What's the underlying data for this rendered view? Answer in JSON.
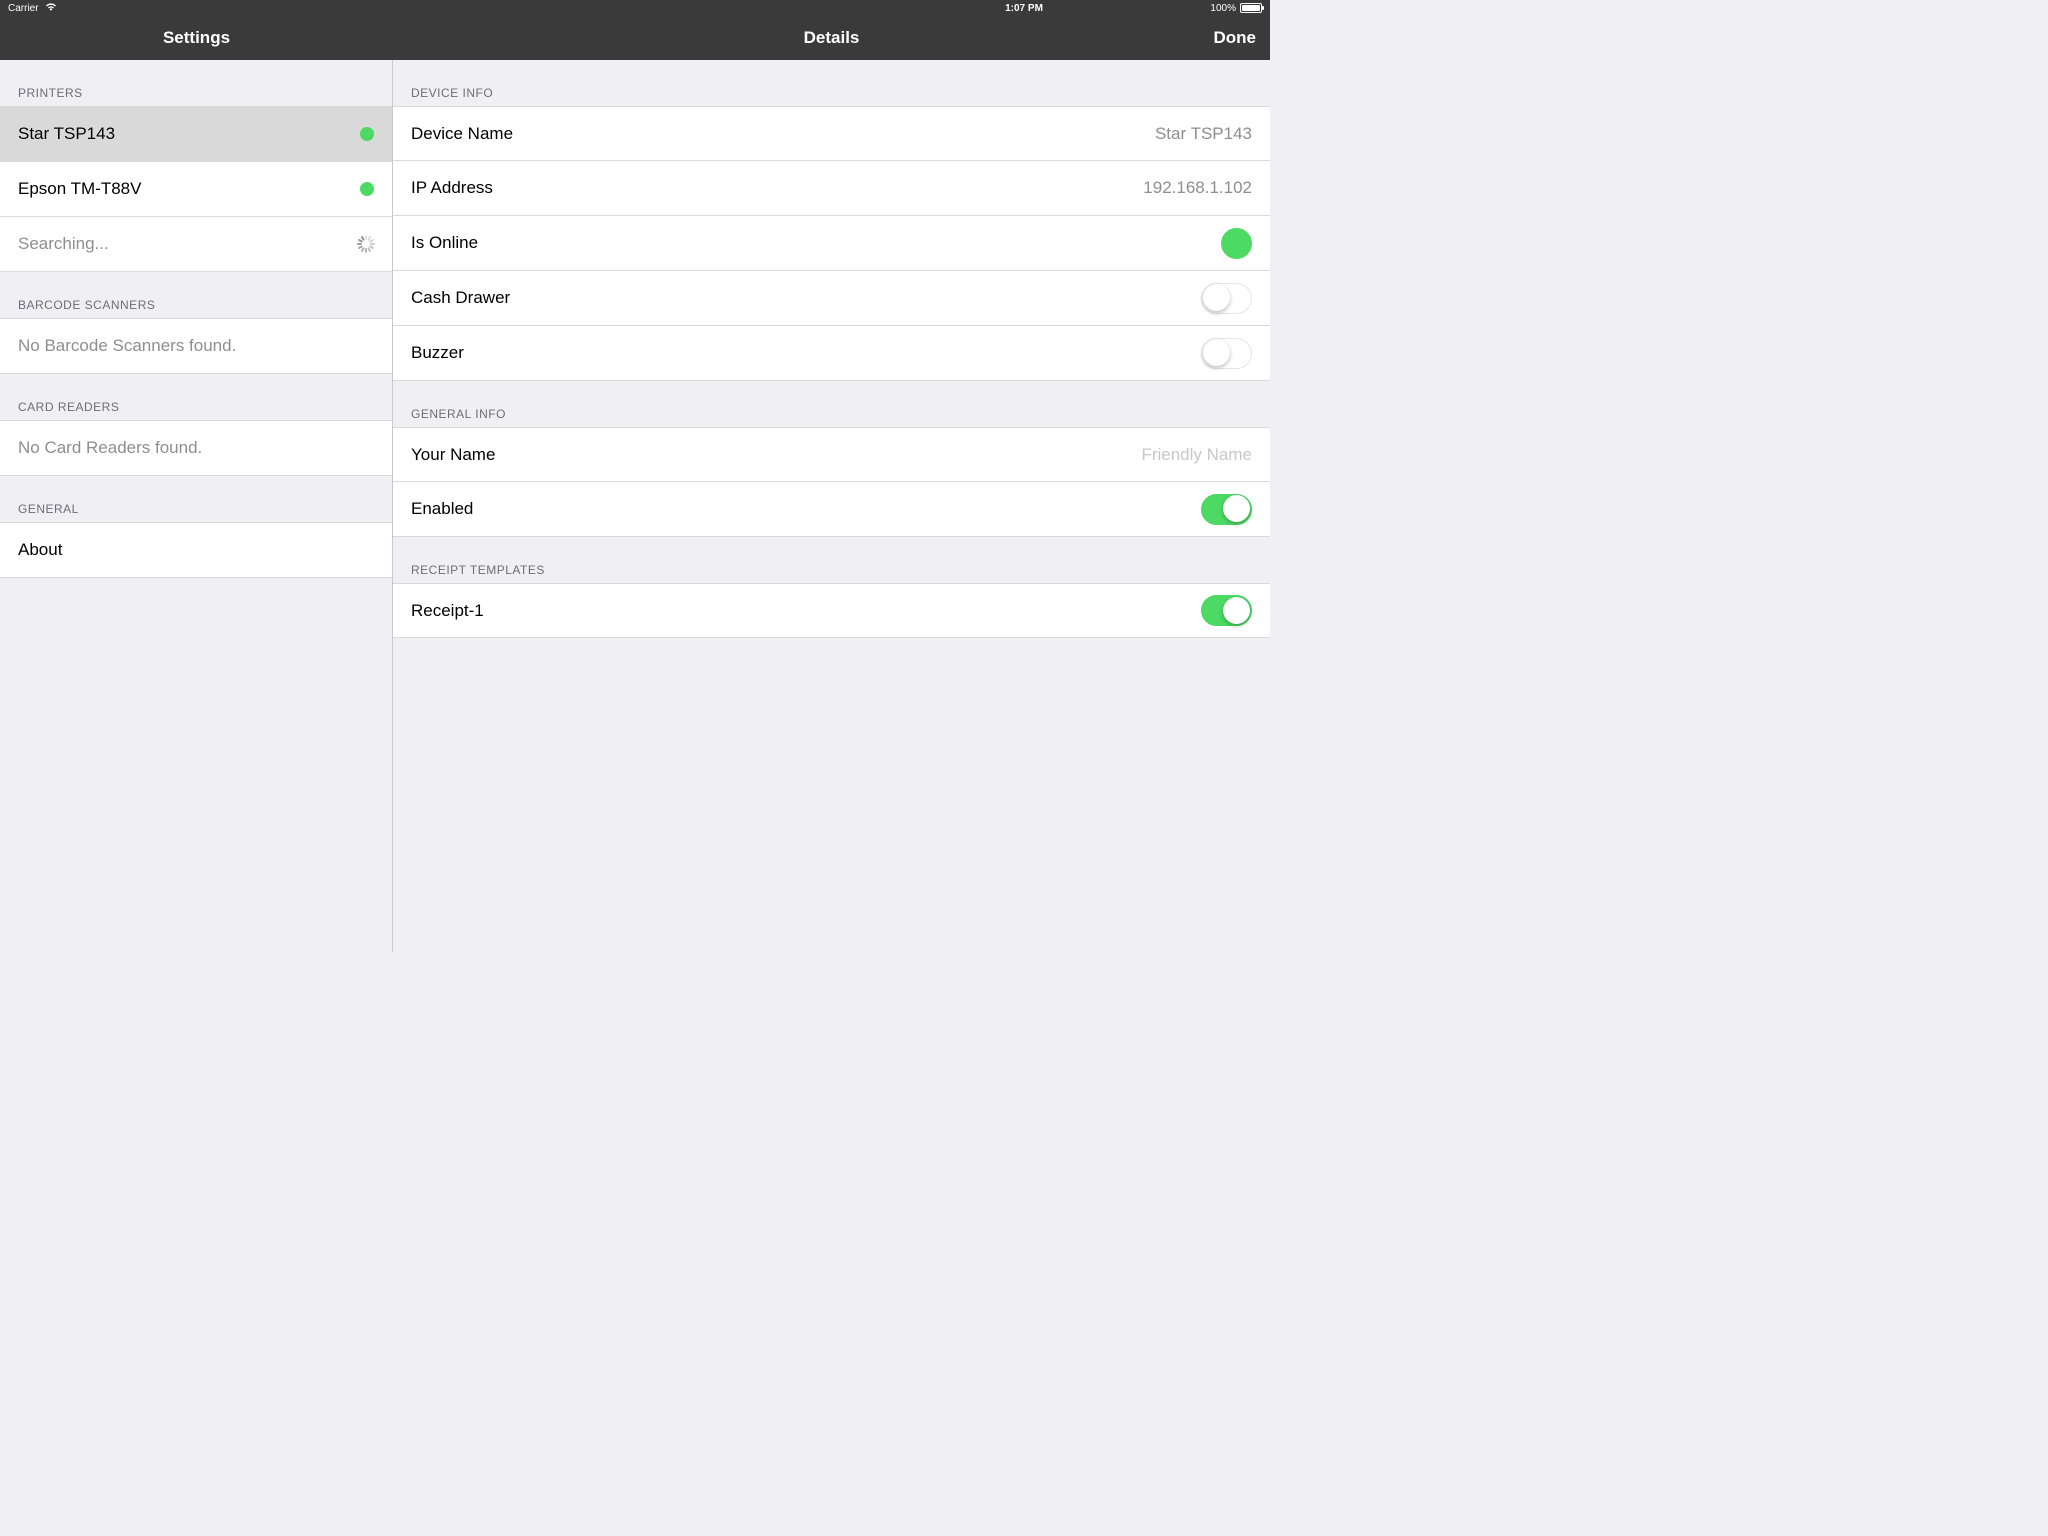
{
  "status": {
    "carrier": "Carrier",
    "time": "1:07 PM",
    "battery_pct": "100%"
  },
  "nav": {
    "left_title": "Settings",
    "right_title": "Details",
    "done": "Done"
  },
  "sidebar": {
    "printers": {
      "header": "PRINTERS",
      "items": [
        {
          "name": "Star TSP143",
          "status": "green",
          "selected": true
        },
        {
          "name": "Epson TM-T88V",
          "status": "green",
          "selected": false
        }
      ],
      "searching": "Searching..."
    },
    "barcode": {
      "header": "BARCODE SCANNERS",
      "empty": "No Barcode Scanners found."
    },
    "cardreaders": {
      "header": "CARD READERS",
      "empty": "No Card Readers found."
    },
    "general": {
      "header": "GENERAL",
      "about": "About"
    }
  },
  "detail": {
    "device_info": {
      "header": "DEVICE INFO",
      "device_name": {
        "label": "Device Name",
        "value": "Star TSP143"
      },
      "ip": {
        "label": "IP Address",
        "value": "192.168.1.102"
      },
      "online": {
        "label": "Is Online",
        "on": true
      },
      "cash_drawer": {
        "label": "Cash Drawer",
        "on": false
      },
      "buzzer": {
        "label": "Buzzer",
        "on": false
      }
    },
    "general_info": {
      "header": "GENERAL INFO",
      "your_name": {
        "label": "Your Name",
        "placeholder": "Friendly Name",
        "value": ""
      },
      "enabled": {
        "label": "Enabled",
        "on": true
      }
    },
    "receipt": {
      "header": "RECEIPT TEMPLATES",
      "item": {
        "label": "Receipt-1",
        "on": true
      }
    }
  }
}
